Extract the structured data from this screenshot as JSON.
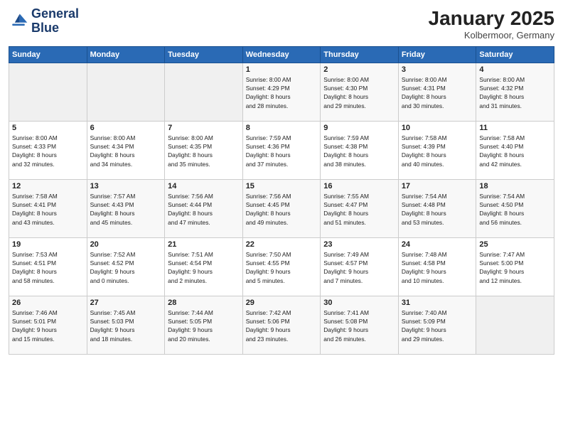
{
  "header": {
    "logo_line1": "General",
    "logo_line2": "Blue",
    "title": "January 2025",
    "location": "Kolbermoor, Germany"
  },
  "weekdays": [
    "Sunday",
    "Monday",
    "Tuesday",
    "Wednesday",
    "Thursday",
    "Friday",
    "Saturday"
  ],
  "weeks": [
    [
      {
        "day": "",
        "info": ""
      },
      {
        "day": "",
        "info": ""
      },
      {
        "day": "",
        "info": ""
      },
      {
        "day": "1",
        "info": "Sunrise: 8:00 AM\nSunset: 4:29 PM\nDaylight: 8 hours\nand 28 minutes."
      },
      {
        "day": "2",
        "info": "Sunrise: 8:00 AM\nSunset: 4:30 PM\nDaylight: 8 hours\nand 29 minutes."
      },
      {
        "day": "3",
        "info": "Sunrise: 8:00 AM\nSunset: 4:31 PM\nDaylight: 8 hours\nand 30 minutes."
      },
      {
        "day": "4",
        "info": "Sunrise: 8:00 AM\nSunset: 4:32 PM\nDaylight: 8 hours\nand 31 minutes."
      }
    ],
    [
      {
        "day": "5",
        "info": "Sunrise: 8:00 AM\nSunset: 4:33 PM\nDaylight: 8 hours\nand 32 minutes."
      },
      {
        "day": "6",
        "info": "Sunrise: 8:00 AM\nSunset: 4:34 PM\nDaylight: 8 hours\nand 34 minutes."
      },
      {
        "day": "7",
        "info": "Sunrise: 8:00 AM\nSunset: 4:35 PM\nDaylight: 8 hours\nand 35 minutes."
      },
      {
        "day": "8",
        "info": "Sunrise: 7:59 AM\nSunset: 4:36 PM\nDaylight: 8 hours\nand 37 minutes."
      },
      {
        "day": "9",
        "info": "Sunrise: 7:59 AM\nSunset: 4:38 PM\nDaylight: 8 hours\nand 38 minutes."
      },
      {
        "day": "10",
        "info": "Sunrise: 7:58 AM\nSunset: 4:39 PM\nDaylight: 8 hours\nand 40 minutes."
      },
      {
        "day": "11",
        "info": "Sunrise: 7:58 AM\nSunset: 4:40 PM\nDaylight: 8 hours\nand 42 minutes."
      }
    ],
    [
      {
        "day": "12",
        "info": "Sunrise: 7:58 AM\nSunset: 4:41 PM\nDaylight: 8 hours\nand 43 minutes."
      },
      {
        "day": "13",
        "info": "Sunrise: 7:57 AM\nSunset: 4:43 PM\nDaylight: 8 hours\nand 45 minutes."
      },
      {
        "day": "14",
        "info": "Sunrise: 7:56 AM\nSunset: 4:44 PM\nDaylight: 8 hours\nand 47 minutes."
      },
      {
        "day": "15",
        "info": "Sunrise: 7:56 AM\nSunset: 4:45 PM\nDaylight: 8 hours\nand 49 minutes."
      },
      {
        "day": "16",
        "info": "Sunrise: 7:55 AM\nSunset: 4:47 PM\nDaylight: 8 hours\nand 51 minutes."
      },
      {
        "day": "17",
        "info": "Sunrise: 7:54 AM\nSunset: 4:48 PM\nDaylight: 8 hours\nand 53 minutes."
      },
      {
        "day": "18",
        "info": "Sunrise: 7:54 AM\nSunset: 4:50 PM\nDaylight: 8 hours\nand 56 minutes."
      }
    ],
    [
      {
        "day": "19",
        "info": "Sunrise: 7:53 AM\nSunset: 4:51 PM\nDaylight: 8 hours\nand 58 minutes."
      },
      {
        "day": "20",
        "info": "Sunrise: 7:52 AM\nSunset: 4:52 PM\nDaylight: 9 hours\nand 0 minutes."
      },
      {
        "day": "21",
        "info": "Sunrise: 7:51 AM\nSunset: 4:54 PM\nDaylight: 9 hours\nand 2 minutes."
      },
      {
        "day": "22",
        "info": "Sunrise: 7:50 AM\nSunset: 4:55 PM\nDaylight: 9 hours\nand 5 minutes."
      },
      {
        "day": "23",
        "info": "Sunrise: 7:49 AM\nSunset: 4:57 PM\nDaylight: 9 hours\nand 7 minutes."
      },
      {
        "day": "24",
        "info": "Sunrise: 7:48 AM\nSunset: 4:58 PM\nDaylight: 9 hours\nand 10 minutes."
      },
      {
        "day": "25",
        "info": "Sunrise: 7:47 AM\nSunset: 5:00 PM\nDaylight: 9 hours\nand 12 minutes."
      }
    ],
    [
      {
        "day": "26",
        "info": "Sunrise: 7:46 AM\nSunset: 5:01 PM\nDaylight: 9 hours\nand 15 minutes."
      },
      {
        "day": "27",
        "info": "Sunrise: 7:45 AM\nSunset: 5:03 PM\nDaylight: 9 hours\nand 18 minutes."
      },
      {
        "day": "28",
        "info": "Sunrise: 7:44 AM\nSunset: 5:05 PM\nDaylight: 9 hours\nand 20 minutes."
      },
      {
        "day": "29",
        "info": "Sunrise: 7:42 AM\nSunset: 5:06 PM\nDaylight: 9 hours\nand 23 minutes."
      },
      {
        "day": "30",
        "info": "Sunrise: 7:41 AM\nSunset: 5:08 PM\nDaylight: 9 hours\nand 26 minutes."
      },
      {
        "day": "31",
        "info": "Sunrise: 7:40 AM\nSunset: 5:09 PM\nDaylight: 9 hours\nand 29 minutes."
      },
      {
        "day": "",
        "info": ""
      }
    ]
  ]
}
